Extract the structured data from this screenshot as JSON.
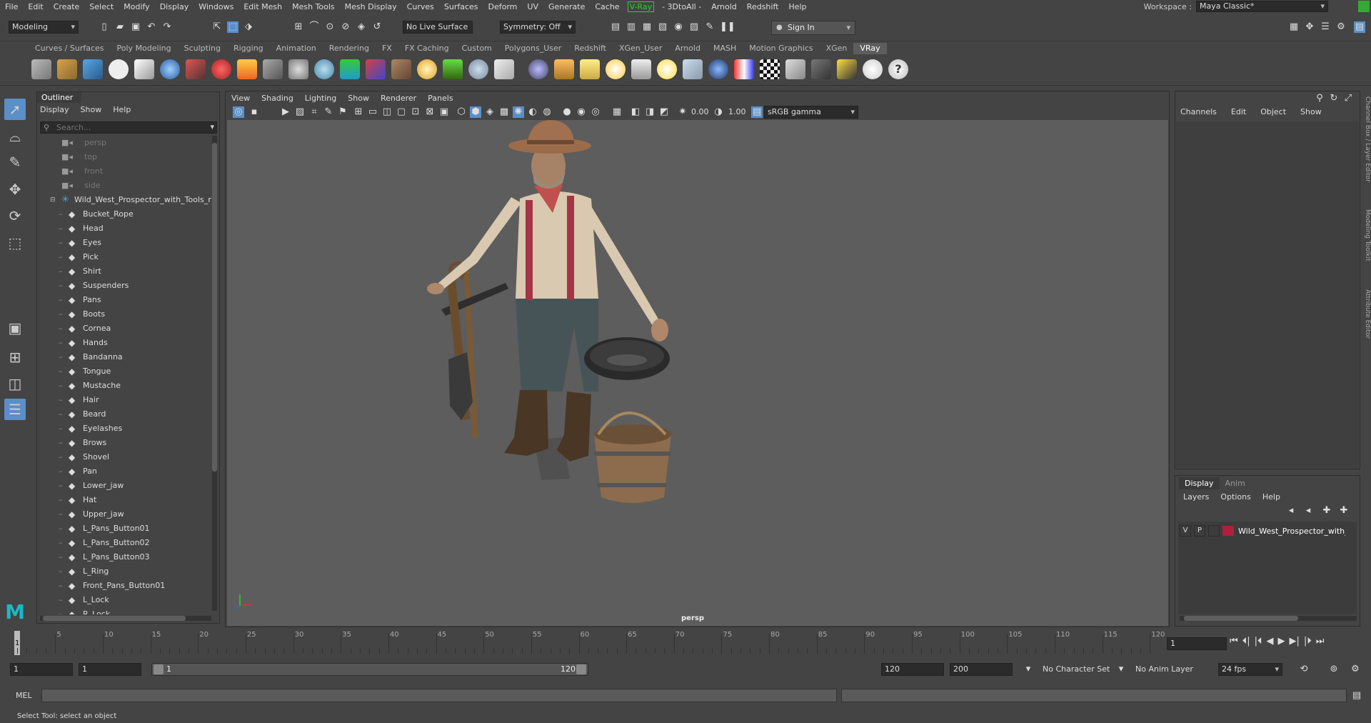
{
  "menubar": {
    "items": [
      "File",
      "Edit",
      "Create",
      "Select",
      "Modify",
      "Display",
      "Windows",
      "Edit Mesh",
      "Mesh Tools",
      "Mesh Display",
      "Curves",
      "Surfaces",
      "Deform",
      "UV",
      "Generate",
      "Cache"
    ],
    "vray": "V-Ray",
    "after": [
      "- 3DtoAll -",
      "Arnold",
      "Redshift",
      "Help"
    ],
    "workspace_label": "Workspace :",
    "workspace_value": "Maya Classic*"
  },
  "statusline": {
    "mode": "Modeling",
    "live_surface": "No Live Surface",
    "symmetry": "Symmetry: Off",
    "sign_in": "Sign In"
  },
  "shelf": {
    "tabs": [
      "Curves / Surfaces",
      "Poly Modeling",
      "Sculpting",
      "Rigging",
      "Animation",
      "Rendering",
      "FX",
      "FX Caching",
      "Custom",
      "Polygons_User",
      "Redshift",
      "XGen_User",
      "Arnold",
      "MASH",
      "Motion Graphics",
      "XGen",
      "VRay"
    ],
    "active_tab": "VRay"
  },
  "outliner": {
    "title": "Outliner",
    "menu": [
      "Display",
      "Show",
      "Help"
    ],
    "search_placeholder": "Search...",
    "cameras": [
      "persp",
      "top",
      "front",
      "side"
    ],
    "group": "Wild_West_Prospector_with_Tools_nc",
    "meshes": [
      "Bucket_Rope",
      "Head",
      "Eyes",
      "Pick",
      "Shirt",
      "Suspenders",
      "Pans",
      "Boots",
      "Cornea",
      "Hands",
      "Bandanna",
      "Tongue",
      "Mustache",
      "Hair",
      "Beard",
      "Eyelashes",
      "Brows",
      "Shovel",
      "Pan",
      "Lower_jaw",
      "Hat",
      "Upper_jaw",
      "L_Pans_Button01",
      "L_Pans_Button02",
      "L_Pans_Button03",
      "L_Ring",
      "Front_Pans_Button01",
      "L_Lock",
      "R_Lock"
    ]
  },
  "viewport": {
    "menu": [
      "View",
      "Shading",
      "Lighting",
      "Show",
      "Renderer",
      "Panels"
    ],
    "exposure": "0.00",
    "gamma": "1.00",
    "color_space": "sRGB gamma",
    "camera_label": "persp"
  },
  "channelbox": {
    "menu": [
      "Channels",
      "Edit",
      "Object",
      "Show"
    ],
    "side_tabs": [
      "Channel Box / Layer Editor",
      "Modeling Toolkit",
      "Attribute Editor"
    ]
  },
  "layereditor": {
    "tabs": [
      "Display",
      "Anim"
    ],
    "menu": [
      "Layers",
      "Options",
      "Help"
    ],
    "layer": {
      "v": "V",
      "p": "P",
      "name": "Wild_West_Prospector_with_Tools",
      "color": "#b0203a"
    }
  },
  "timeline": {
    "tick_labels": [
      "5",
      "10",
      "15",
      "20",
      "25",
      "30",
      "35",
      "40",
      "45",
      "50",
      "55",
      "60",
      "65",
      "70",
      "75",
      "80",
      "85",
      "90",
      "95",
      "100",
      "105",
      "110",
      "115",
      "120"
    ],
    "current_marker": "1",
    "current_frame": "1"
  },
  "range": {
    "start": "1",
    "playback_start": "1",
    "slider_start": "1",
    "slider_end": "120",
    "playback_end": "120",
    "end": "200",
    "character_set": "No Character Set",
    "anim_layer": "No Anim Layer",
    "fps": "24 fps"
  },
  "command": {
    "label": "MEL",
    "help_text": "Select Tool: select an object"
  }
}
